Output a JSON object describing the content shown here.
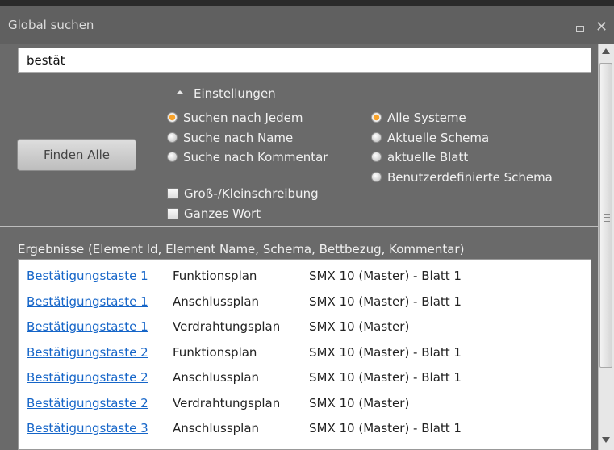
{
  "window": {
    "title": "Global suchen"
  },
  "search": {
    "value": "bestät"
  },
  "find_all_label": "Finden Alle",
  "settings": {
    "toggle_label": "Einstellungen",
    "search_mode": [
      {
        "label": "Suchen nach Jedem",
        "selected": true
      },
      {
        "label": "Suche nach Name",
        "selected": false
      },
      {
        "label": "Suche nach Kommentar",
        "selected": false
      }
    ],
    "scope": [
      {
        "label": "Alle Systeme",
        "selected": true
      },
      {
        "label": "Aktuelle Schema",
        "selected": false
      },
      {
        "label": "aktuelle Blatt",
        "selected": false
      },
      {
        "label": "Benutzerdefinierte Schema",
        "selected": false
      }
    ],
    "checkboxes": [
      {
        "label": "Groß-/Kleinschreibung",
        "checked": false
      },
      {
        "label": "Ganzes Wort",
        "checked": false
      }
    ]
  },
  "results": {
    "header": "Ergebnisse (Element Id, Element Name, Schema, Bettbezug, Kommentar)",
    "rows": [
      {
        "element": "Bestätigungstaste 1",
        "plan": "Funktionsplan",
        "schema": "SMX 10 (Master) - Blatt 1"
      },
      {
        "element": "Bestätigungstaste 1",
        "plan": "Anschlussplan",
        "schema": "SMX 10 (Master) - Blatt 1"
      },
      {
        "element": "Bestätigungstaste 1",
        "plan": "Verdrahtungsplan",
        "schema": "SMX 10 (Master)"
      },
      {
        "element": "Bestätigungstaste 2",
        "plan": "Funktionsplan",
        "schema": "SMX 10 (Master) - Blatt 1"
      },
      {
        "element": "Bestätigungstaste 2",
        "plan": "Anschlussplan",
        "schema": "SMX 10 (Master) - Blatt 1"
      },
      {
        "element": "Bestätigungstaste 2",
        "plan": "Verdrahtungsplan",
        "schema": "SMX 10 (Master)"
      },
      {
        "element": "Bestätigungstaste 3",
        "plan": "Anschlussplan",
        "schema": "SMX 10 (Master) - Blatt 1"
      }
    ]
  },
  "colors": {
    "accent_radio": "#f7a22a",
    "link": "#1565c8",
    "panel_bg": "#6a6a6a"
  }
}
